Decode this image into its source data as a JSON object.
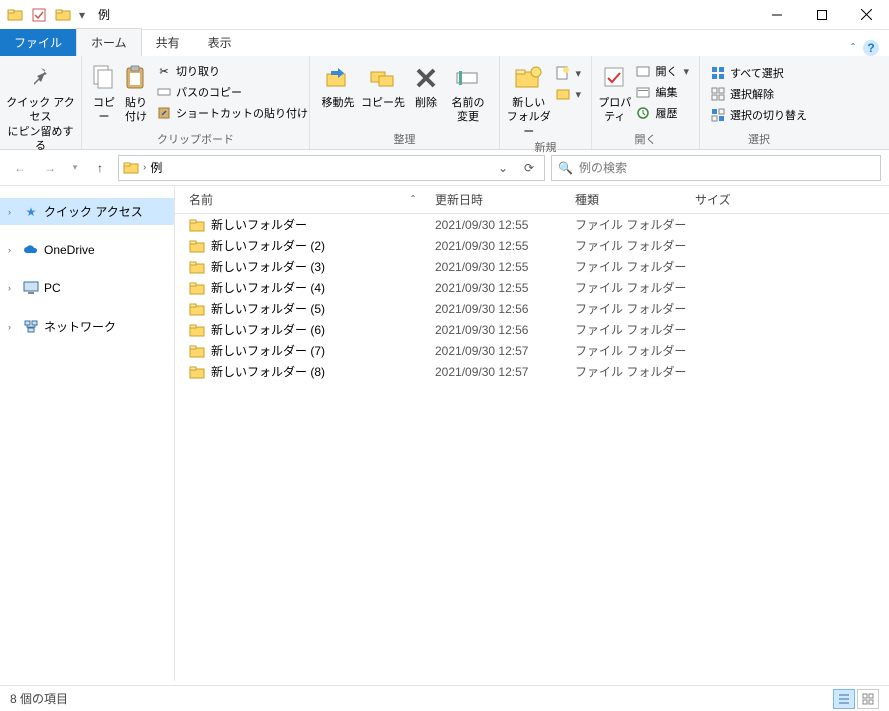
{
  "window": {
    "title": "例"
  },
  "tabs": {
    "file": "ファイル",
    "home": "ホーム",
    "share": "共有",
    "view": "表示"
  },
  "ribbon": {
    "pin": "クイック アクセス\nにピン留めする",
    "copy": "コピー",
    "paste": "貼り付け",
    "cut": "切り取り",
    "copy_path": "パスのコピー",
    "paste_shortcut": "ショートカットの貼り付け",
    "clipboard_group": "クリップボード",
    "move_to": "移動先",
    "copy_to": "コピー先",
    "delete": "削除",
    "rename": "名前の\n変更",
    "organize_group": "整理",
    "new_folder": "新しい\nフォルダー",
    "new_group": "新規",
    "properties": "プロパティ",
    "open": "開く",
    "edit": "編集",
    "history": "履歴",
    "open_group": "開く",
    "select_all": "すべて選択",
    "select_none": "選択解除",
    "invert_selection": "選択の切り替え",
    "select_group": "選択"
  },
  "address": {
    "folder": "例"
  },
  "search": {
    "placeholder": "例の検索"
  },
  "nav": {
    "quick_access": "クイック アクセス",
    "onedrive": "OneDrive",
    "pc": "PC",
    "network": "ネットワーク"
  },
  "columns": {
    "name": "名前",
    "date": "更新日時",
    "type": "種類",
    "size": "サイズ"
  },
  "files": [
    {
      "name": "新しいフォルダー",
      "date": "2021/09/30 12:55",
      "type": "ファイル フォルダー"
    },
    {
      "name": "新しいフォルダー (2)",
      "date": "2021/09/30 12:55",
      "type": "ファイル フォルダー"
    },
    {
      "name": "新しいフォルダー (3)",
      "date": "2021/09/30 12:55",
      "type": "ファイル フォルダー"
    },
    {
      "name": "新しいフォルダー (4)",
      "date": "2021/09/30 12:55",
      "type": "ファイル フォルダー"
    },
    {
      "name": "新しいフォルダー (5)",
      "date": "2021/09/30 12:56",
      "type": "ファイル フォルダー"
    },
    {
      "name": "新しいフォルダー (6)",
      "date": "2021/09/30 12:56",
      "type": "ファイル フォルダー"
    },
    {
      "name": "新しいフォルダー (7)",
      "date": "2021/09/30 12:57",
      "type": "ファイル フォルダー"
    },
    {
      "name": "新しいフォルダー (8)",
      "date": "2021/09/30 12:57",
      "type": "ファイル フォルダー"
    }
  ],
  "status": {
    "count": "8 個の項目"
  }
}
